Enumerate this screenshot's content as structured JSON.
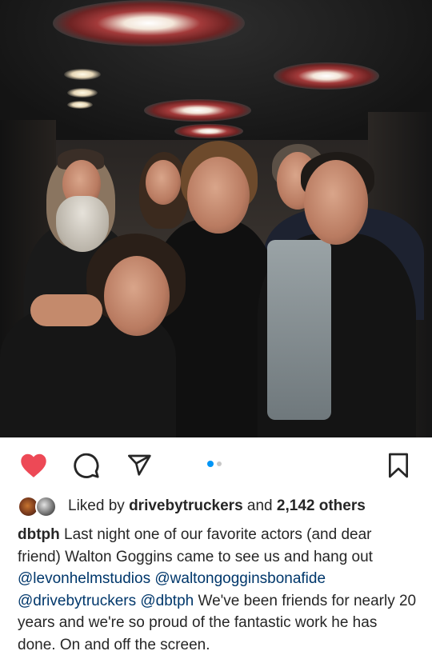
{
  "post": {
    "photo_alt": "Group photo",
    "carousel": {
      "count": 2,
      "active_index": 0
    }
  },
  "colors": {
    "like_red": "#ed4956",
    "mention_blue": "#00376b",
    "text": "#262626",
    "dot_active": "#0095f6",
    "dot_inactive": "#c7c7c7"
  },
  "icons": {
    "like": "heart-icon",
    "comment": "speech-bubble-icon",
    "share": "paper-plane-icon",
    "save": "bookmark-icon"
  },
  "likes": {
    "prefix": "Liked by",
    "user": "drivebytruckers",
    "joiner": "and",
    "others": "2,142 others"
  },
  "caption": {
    "username": "dbtph",
    "text_1": "Last night one of our favorite actors (and dear friend) Walton Goggins came to see us and hang out",
    "mention_1": "@levonhelmstudios",
    "mention_2": "@waltongogginsbonafide",
    "mention_3": "@drivebytruckers",
    "mention_4": "@dbtph",
    "text_2": "We've been friends for nearly 20 years and we're so proud of the fantastic work he has done. On and off the screen."
  }
}
